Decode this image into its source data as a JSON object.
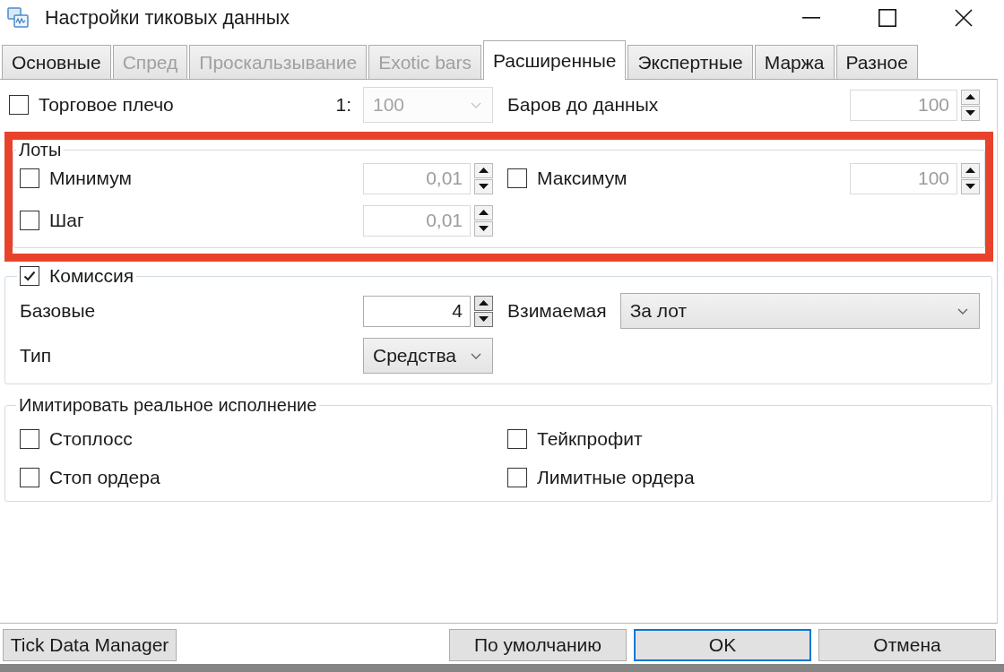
{
  "window": {
    "title": "Настройки тиковых данных"
  },
  "tabs": [
    {
      "label": "Основные",
      "selected": false,
      "disabled": false
    },
    {
      "label": "Спред",
      "selected": false,
      "disabled": true
    },
    {
      "label": "Проскальзывание",
      "selected": false,
      "disabled": true
    },
    {
      "label": "Exotic bars",
      "selected": false,
      "disabled": true
    },
    {
      "label": "Расширенные",
      "selected": true,
      "disabled": false
    },
    {
      "label": "Экспертные",
      "selected": false,
      "disabled": false
    },
    {
      "label": "Маржа",
      "selected": false,
      "disabled": false
    },
    {
      "label": "Разное",
      "selected": false,
      "disabled": false
    }
  ],
  "leverage": {
    "label": "Торговое плечо",
    "checked": false,
    "ratio_prefix": "1:",
    "value": "100",
    "disabled": true
  },
  "bars_before_data": {
    "label": "Баров до данных",
    "value": "100",
    "disabled": true
  },
  "lots": {
    "title": "Лоты",
    "highlighted": true,
    "fields": [
      {
        "label": "Минимум",
        "checked": false,
        "value": "0,01",
        "disabled": true
      },
      {
        "label": "Максимум",
        "checked": false,
        "value": "100",
        "disabled": true
      },
      {
        "label": "Шаг",
        "checked": false,
        "value": "0,01",
        "disabled": true
      }
    ]
  },
  "commission": {
    "label": "Комиссия",
    "checked": true,
    "base": {
      "label": "Базовые",
      "value": "4",
      "disabled": false
    },
    "charged": {
      "label": "Взимаемая",
      "value": "За лот",
      "disabled": false
    },
    "type": {
      "label": "Тип",
      "value": "Средства",
      "disabled": false
    }
  },
  "real_execution": {
    "title": "Имитировать реальное исполнение",
    "options": [
      {
        "label": "Стоплосс",
        "checked": false
      },
      {
        "label": "Тейкпрофит",
        "checked": false
      },
      {
        "label": "Стоп ордера",
        "checked": false
      },
      {
        "label": "Лимитные ордера",
        "checked": false
      }
    ]
  },
  "buttons": [
    {
      "label": "Tick Data Manager",
      "default": false
    },
    {
      "label": "По умолчанию",
      "default": false
    },
    {
      "label": "OK",
      "default": true
    },
    {
      "label": "Отмена",
      "default": false
    }
  ]
}
